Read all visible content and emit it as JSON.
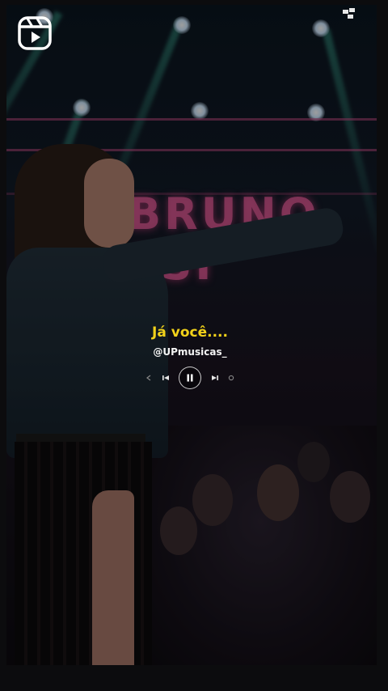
{
  "app": {
    "icon": "reels-icon",
    "corner_icon": "corner-logo-icon"
  },
  "video": {
    "sign_text": "BRUNO\nSSI",
    "caption": "Já você....",
    "handle": "@UPmusicas_"
  },
  "player": {
    "controls": [
      {
        "name": "rewind-icon"
      },
      {
        "name": "previous-icon"
      },
      {
        "name": "pause-icon"
      },
      {
        "name": "next-icon"
      },
      {
        "name": "forward-icon"
      }
    ]
  },
  "colors": {
    "caption": "#f2d21a",
    "handle": "#f4f4f4",
    "background": "#0c0c0e"
  }
}
